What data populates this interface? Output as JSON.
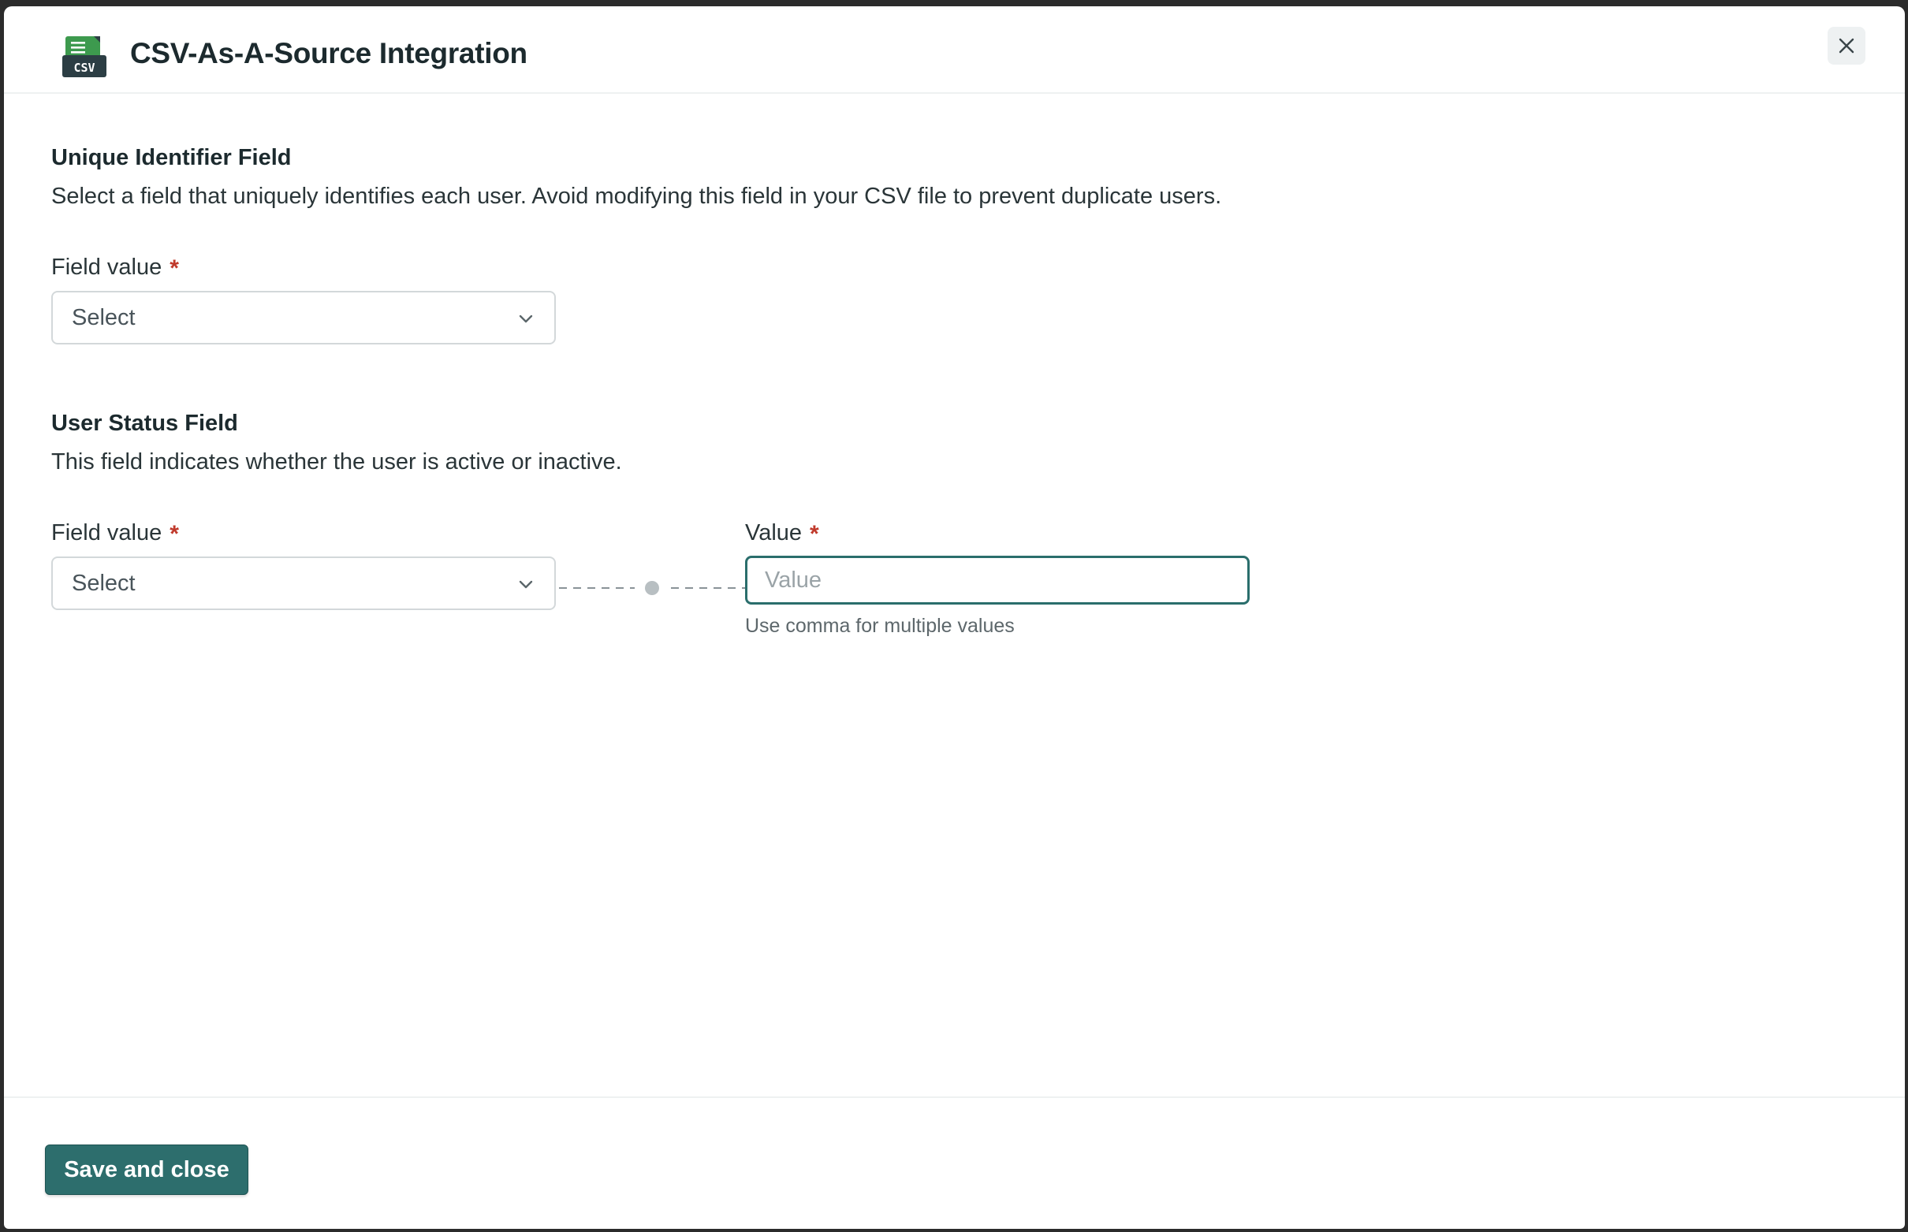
{
  "header": {
    "icon_text": "CSV",
    "title": "CSV-As-A-Source Integration"
  },
  "unique_identifier": {
    "title": "Unique Identifier Field",
    "description": "Select a field that uniquely identifies each user. Avoid modifying this field in your CSV file to prevent duplicate users.",
    "field_label": "Field value",
    "required_mark": "*",
    "select_value": "Select"
  },
  "user_status": {
    "title": "User Status Field",
    "description": "This field indicates whether the user is active or inactive.",
    "field_label": "Field value",
    "required_mark": "*",
    "select_value": "Select",
    "value_label": "Value",
    "value_required_mark": "*",
    "value_placeholder": "Value",
    "value_hint": "Use comma for multiple values"
  },
  "footer": {
    "save_label": "Save and close"
  },
  "colors": {
    "accent": "#2d6e6d",
    "required": "#c0392b",
    "icon_green": "#3d9a4e",
    "icon_dark": "#2c3e44"
  }
}
